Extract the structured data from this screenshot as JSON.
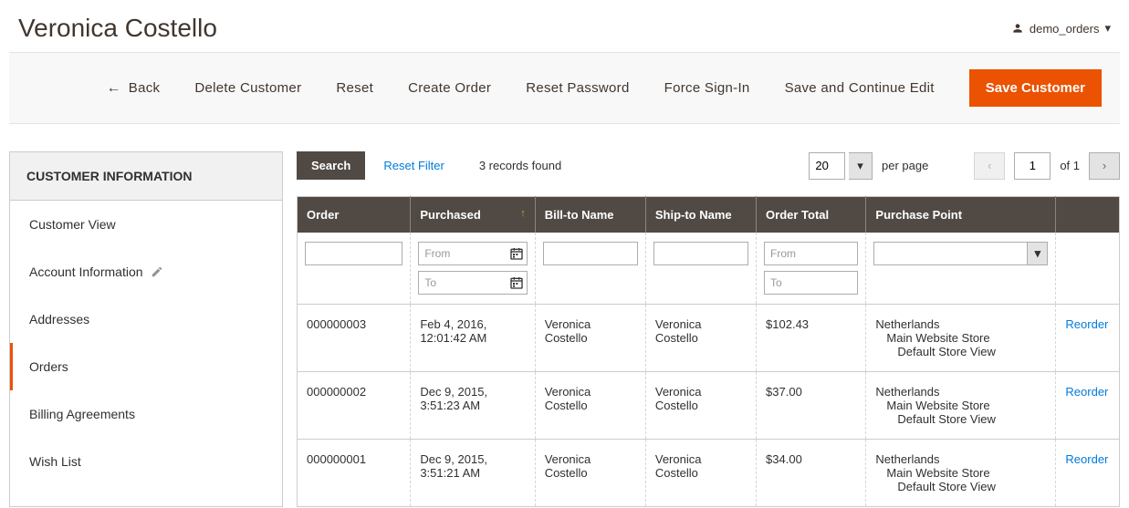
{
  "header": {
    "page_title": "Veronica Costello",
    "user_label": "demo_orders"
  },
  "actions": {
    "back": "Back",
    "delete": "Delete Customer",
    "reset": "Reset",
    "create_order": "Create Order",
    "reset_password": "Reset Password",
    "force_signin": "Force Sign-In",
    "save_continue": "Save and Continue Edit",
    "save": "Save Customer"
  },
  "sidebar": {
    "title": "CUSTOMER INFORMATION",
    "items": [
      {
        "label": "Customer View"
      },
      {
        "label": "Account Information"
      },
      {
        "label": "Addresses"
      },
      {
        "label": "Orders"
      },
      {
        "label": "Billing Agreements"
      },
      {
        "label": "Wish List"
      }
    ]
  },
  "grid_toolbar": {
    "search": "Search",
    "reset_filter": "Reset Filter",
    "records_found": "3 records found",
    "per_page_value": "20",
    "per_page_label": "per page",
    "current_page": "1",
    "of_label": "of 1"
  },
  "columns": {
    "order": "Order",
    "purchased": "Purchased",
    "bill_to": "Bill-to Name",
    "ship_to": "Ship-to Name",
    "total": "Order Total",
    "purchase_point": "Purchase Point"
  },
  "filters": {
    "from_placeholder": "From",
    "to_placeholder": "To"
  },
  "rows": [
    {
      "order": "000000003",
      "purchased": "Feb 4, 2016, 12:01:42 AM",
      "bill_to": "Veronica Costello",
      "ship_to": "Veronica Costello",
      "total": "$102.43",
      "pp1": "Netherlands",
      "pp2": "Main Website Store",
      "pp3": "Default Store View",
      "action": "Reorder"
    },
    {
      "order": "000000002",
      "purchased": "Dec 9, 2015, 3:51:23 AM",
      "bill_to": "Veronica Costello",
      "ship_to": "Veronica Costello",
      "total": "$37.00",
      "pp1": "Netherlands",
      "pp2": "Main Website Store",
      "pp3": "Default Store View",
      "action": "Reorder"
    },
    {
      "order": "000000001",
      "purchased": "Dec 9, 2015, 3:51:21 AM",
      "bill_to": "Veronica Costello",
      "ship_to": "Veronica Costello",
      "total": "$34.00",
      "pp1": "Netherlands",
      "pp2": "Main Website Store",
      "pp3": "Default Store View",
      "action": "Reorder"
    }
  ]
}
